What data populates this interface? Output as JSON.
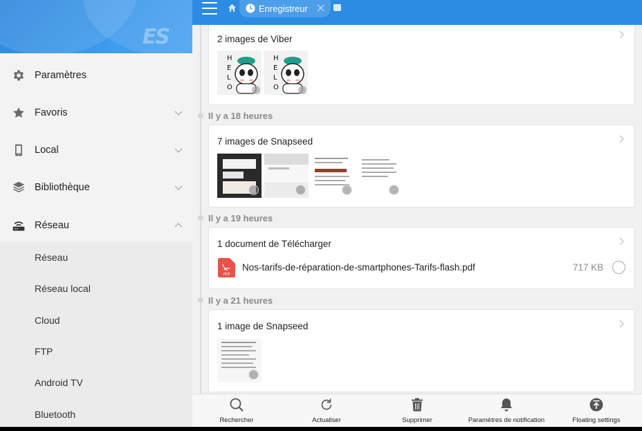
{
  "sidebar": {
    "items": [
      {
        "label": "Paramètres",
        "icon": "gear-icon"
      },
      {
        "label": "Favoris",
        "icon": "star-icon"
      },
      {
        "label": "Local",
        "icon": "phone-icon"
      },
      {
        "label": "Bibliothèque",
        "icon": "library-stack-icon"
      },
      {
        "label": "Réseau",
        "icon": "router-icon"
      }
    ],
    "network_sub_items": [
      "Réseau",
      "Réseau local",
      "Cloud",
      "FTP",
      "Android TV",
      "Bluetooth"
    ]
  },
  "topbar": {
    "tab_label": "Enregistreur"
  },
  "groups": [
    {
      "header": "",
      "card_title": "2 images de Viber"
    },
    {
      "header": "Il y a 18 heures",
      "card_title": "7 images de Snapseed"
    },
    {
      "header": "Il y a 19 heures",
      "card_title": "1 document de Télécharger",
      "file": {
        "name": "Nos-tarifs-de-réparation-de-smartphones-Tarifs-flash.pdf",
        "size": "717 KB",
        "type_label": "PDF"
      }
    },
    {
      "header": "Il y a 21 heures",
      "card_title": "1 image de Snapseed"
    }
  ],
  "bottombar": {
    "items": [
      {
        "label": "Rechercher",
        "icon": "search-icon"
      },
      {
        "label": "Actualiser",
        "icon": "refresh-icon"
      },
      {
        "label": "Supprimer",
        "icon": "trash-icon"
      },
      {
        "label": "Paramètres de notification",
        "icon": "bell-icon"
      },
      {
        "label": "Floating settings",
        "icon": "upload-circle-icon"
      }
    ]
  },
  "logo_text": "ES",
  "colors": {
    "accent": "#2c8be3",
    "sidebar_bg": "#f3f3f3",
    "pdf_red": "#e8524a"
  }
}
